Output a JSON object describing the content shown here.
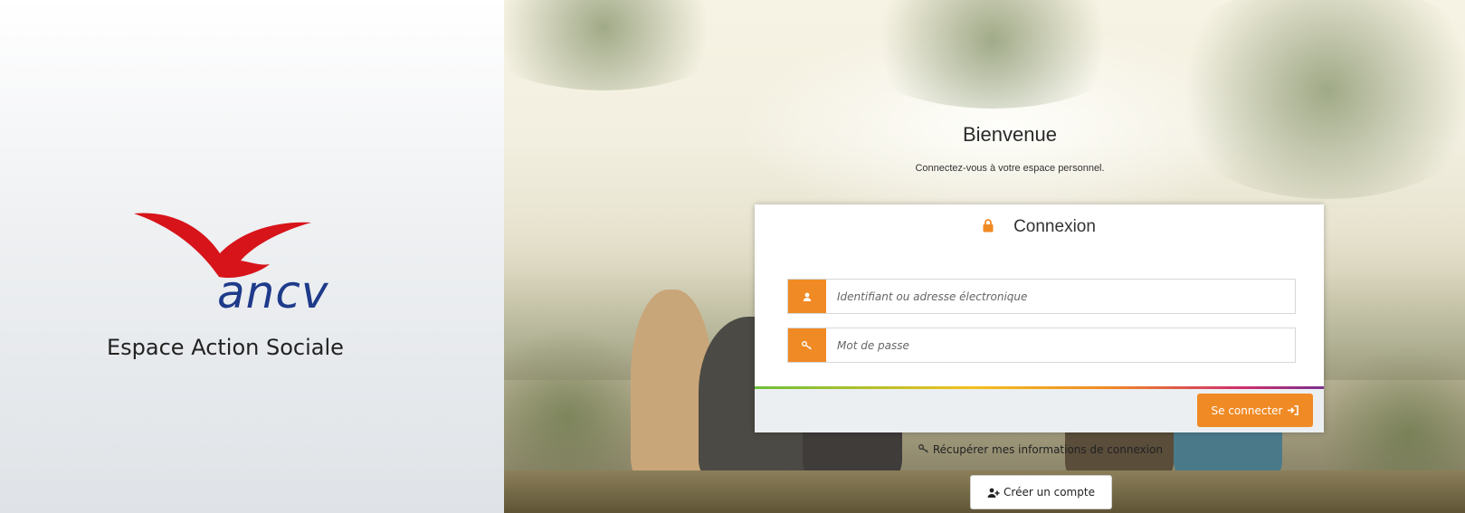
{
  "brand": {
    "logo_text": "ancv",
    "subtitle": "Espace Action Sociale",
    "logo_bird_color": "#d7141a",
    "logo_text_color": "#1e3a8a"
  },
  "welcome": {
    "title": "Bienvenue",
    "subtitle": "Connectez-vous à votre espace personnel."
  },
  "login_card": {
    "title": "Connexion",
    "title_icon": "lock-icon",
    "username_placeholder": "Identifiant ou adresse électronique",
    "username_icon": "user-icon",
    "password_placeholder": "Mot de passe",
    "password_icon": "key-icon",
    "submit_label": "Se connecter",
    "submit_icon": "sign-in-icon",
    "accent_color": "#f08a24"
  },
  "links": {
    "recover_label": "Récupérer mes informations de connexion",
    "recover_icon": "key-icon",
    "create_account_label": "Créer un compte",
    "create_account_icon": "add-user-icon"
  }
}
